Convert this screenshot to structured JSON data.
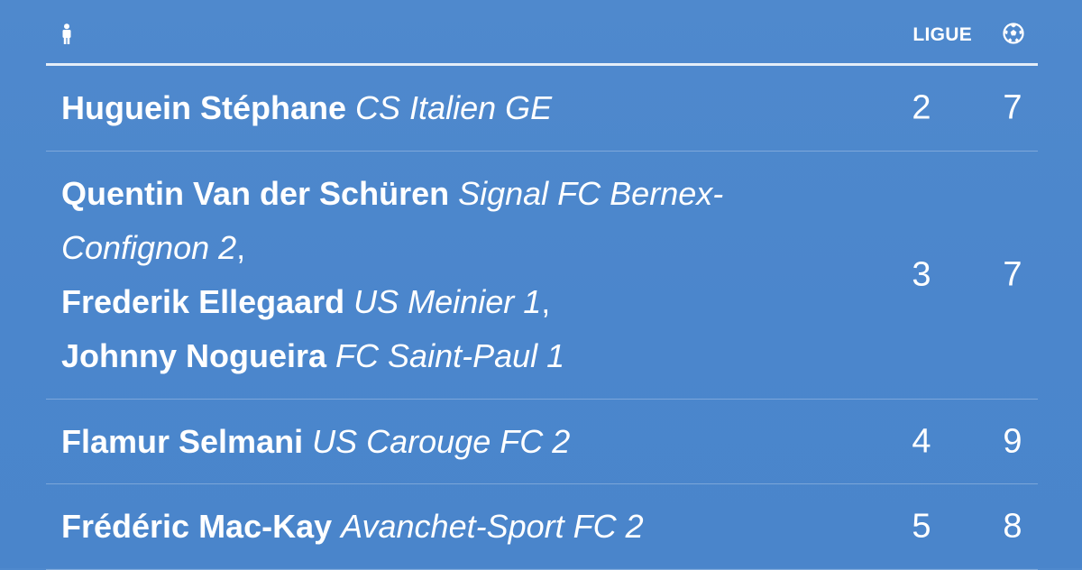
{
  "header": {
    "player_icon": "person-icon",
    "ligue_label": "LIGUE",
    "goals_icon": "soccer-ball-icon"
  },
  "rows": [
    {
      "entries": [
        {
          "name": "Huguein Stéphane",
          "club": "CS Italien GE",
          "suffix": ""
        }
      ],
      "ligue": "2",
      "goals": "7"
    },
    {
      "entries": [
        {
          "name": "Quentin Van der Schüren",
          "club": "Signal FC Bernex-Confignon 2",
          "suffix": ","
        },
        {
          "name": "Frederik Ellegaard",
          "club": "US Meinier 1",
          "suffix": ","
        },
        {
          "name": "Johnny Nogueira",
          "club": "FC Saint-Paul 1",
          "suffix": ""
        }
      ],
      "ligue": "3",
      "goals": "7"
    },
    {
      "entries": [
        {
          "name": "Flamur Selmani",
          "club": "US Carouge FC 2",
          "suffix": ""
        }
      ],
      "ligue": "4",
      "goals": "9"
    },
    {
      "entries": [
        {
          "name": "Frédéric Mac-Kay",
          "club": "Avanchet-Sport FC 2",
          "suffix": ""
        }
      ],
      "ligue": "5",
      "goals": "8"
    }
  ]
}
